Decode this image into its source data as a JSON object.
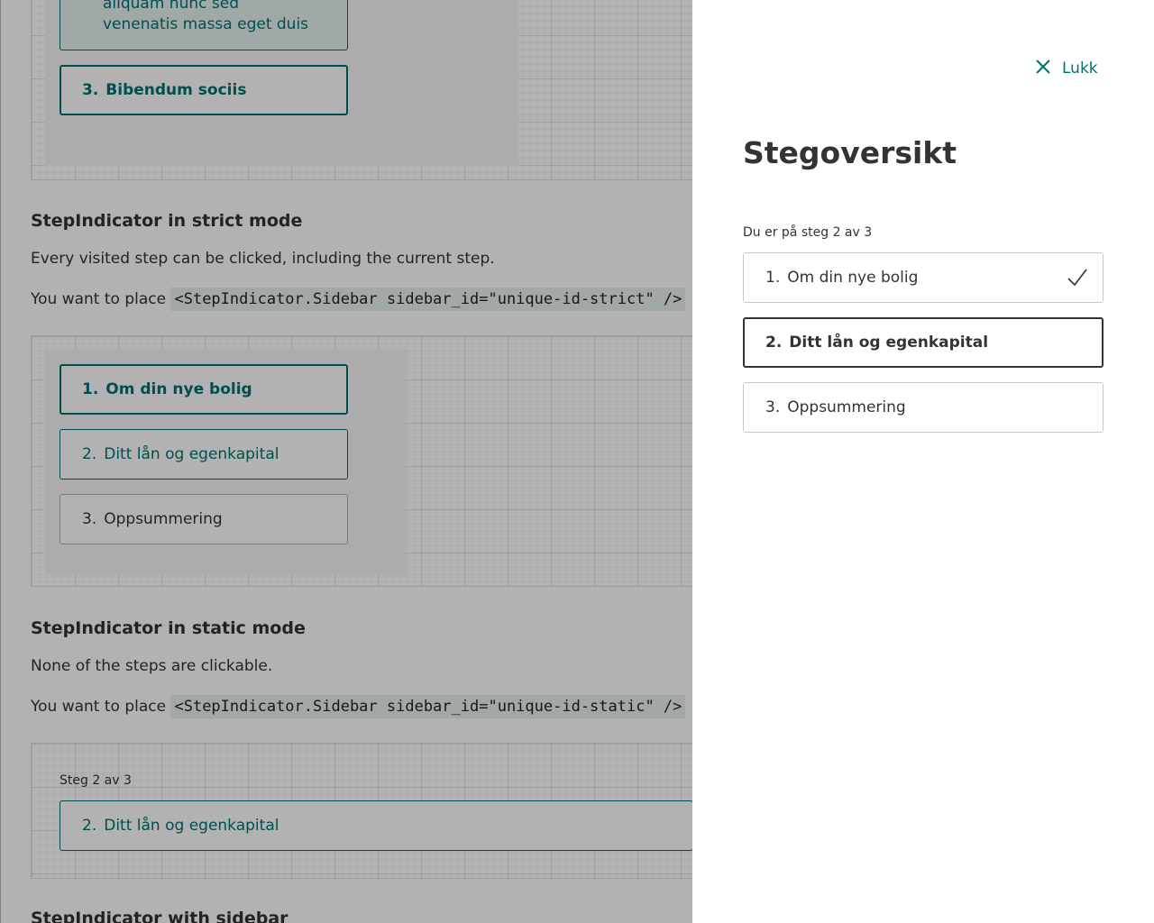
{
  "background": {
    "first_demo": {
      "partial_step_text": [
        "aliquam nunc sed",
        "venenatis massa eget duis"
      ],
      "step3": {
        "num": "3.",
        "label": "Bibendum sociis"
      }
    },
    "strict": {
      "heading": "StepIndicator in strict mode",
      "description": "Every visited step can be clicked, including the current step.",
      "place_prefix": "You want to place",
      "code": "<StepIndicator.Sidebar sidebar_id=\"unique-id-strict\" />",
      "steps": [
        {
          "num": "1.",
          "label": "Om din nye bolig"
        },
        {
          "num": "2.",
          "label": "Ditt lån og egenkapital"
        },
        {
          "num": "3.",
          "label": "Oppsummering"
        }
      ]
    },
    "static": {
      "heading": "StepIndicator in static mode",
      "description": "None of the steps are clickable.",
      "place_prefix": "You want to place",
      "code": "<StepIndicator.Sidebar sidebar_id=\"unique-id-static\" />",
      "progress": "Steg 2 av 3",
      "current_step": {
        "num": "2.",
        "label": "Ditt lån og egenkapital"
      }
    },
    "next_heading": "StepIndicator with sidebar"
  },
  "drawer": {
    "close_label": "Lukk",
    "title": "Stegoversikt",
    "progress": "Du er på steg 2 av 3",
    "steps": [
      {
        "num": "1.",
        "label": "Om din nye bolig",
        "state": "completed"
      },
      {
        "num": "2.",
        "label": "Ditt lån og egenkapital",
        "state": "current"
      },
      {
        "num": "3.",
        "label": "Oppsummering",
        "state": "upcoming"
      }
    ]
  },
  "colors": {
    "accent": "#007272",
    "overlay": "rgba(0,0,0,0.3)",
    "text": "#333333"
  }
}
